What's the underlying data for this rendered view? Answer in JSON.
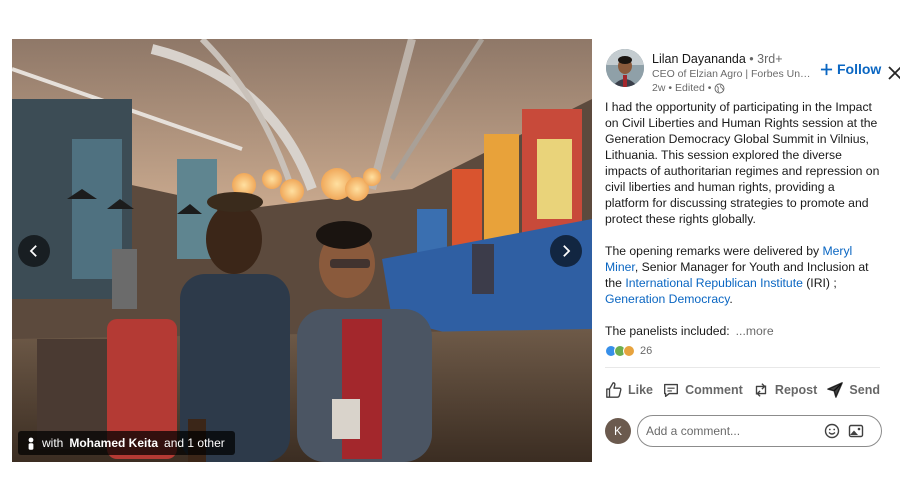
{
  "media": {
    "tag_prefix": "with",
    "tag_name": "Mohamed Keita",
    "tag_suffix": "and 1 other",
    "prev_icon": "chevron-left-icon",
    "next_icon": "chevron-right-icon"
  },
  "post": {
    "author": {
      "name": "Lilan Dayananda",
      "degree": " • 3rd+",
      "headline": "CEO of Elzian Agro | Forbes Unde...",
      "time": "2w •",
      "edited": "Edited •"
    },
    "follow_label": "Follow",
    "body": {
      "para1": "I had the opportunity of participating in the Impact on Civil Liberties and Human Rights session at the Generation Democracy Global Summit in Vilnius, Lithuania. This session explored the diverse impacts of authoritarian regimes and repression on civil liberties and human rights, providing a platform for discussing strategies to promote and protect these rights globally.",
      "p2_a": "The opening remarks were delivered by ",
      "p2_link1": "Meryl Miner",
      "p2_b": ", Senior Manager for Youth and Inclusion at the ",
      "p2_link2": "International Republican Institute",
      "p2_c": " (IRI) ; ",
      "p2_link3": "Generation Democracy",
      "p2_d": ".",
      "p3": "The panelists included:",
      "more": "...more"
    },
    "reactions_count": "26",
    "actions": {
      "like": "Like",
      "comment": "Comment",
      "repost": "Repost",
      "send": "Send"
    },
    "comment": {
      "avatar_initial": "K",
      "placeholder": "Add a comment..."
    }
  },
  "colors": {
    "link": "#0a66c2",
    "muted": "rgba(0,0,0,0.6)",
    "like_reaction": "#378fe9",
    "support_reaction": "#6dae4f",
    "celebrate_reaction": "#e7a33e"
  }
}
